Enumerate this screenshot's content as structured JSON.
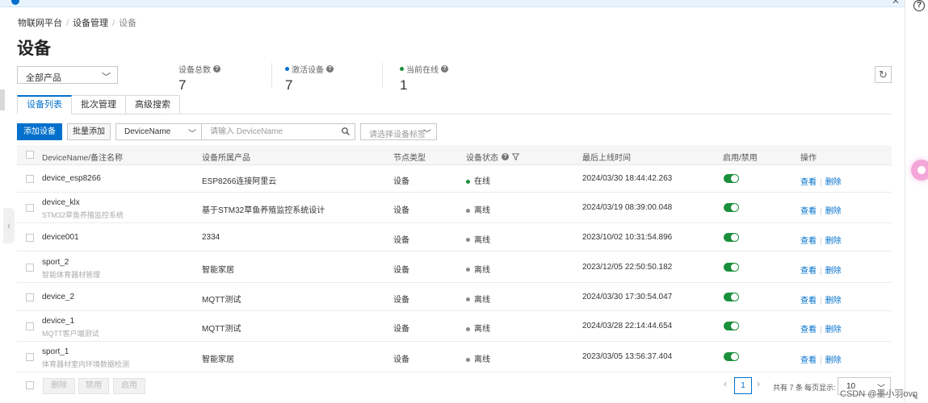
{
  "breadcrumb": [
    "物联网平台",
    "设备管理",
    "设备"
  ],
  "page_title": "设备",
  "product_filter": "全部产品",
  "stats": [
    {
      "label": "设备总数",
      "value": "7",
      "dot": ""
    },
    {
      "label": "激活设备",
      "value": "7",
      "dot": "#0070cc"
    },
    {
      "label": "当前在线",
      "value": "1",
      "dot": "#1b8f3c"
    }
  ],
  "tabs": [
    "设备列表",
    "批次管理",
    "高级搜索"
  ],
  "toolbar": {
    "add_label": "添加设备",
    "batch_label": "批量添加",
    "field_value": "DeviceName",
    "search_placeholder": "请输入 DeviceName",
    "tag_placeholder": "请选择设备标签"
  },
  "columns": {
    "name": "DeviceName/备注名称",
    "product": "设备所属产品",
    "node": "节点类型",
    "status": "设备状态",
    "last_online": "最后上线时间",
    "enable": "启用/禁用",
    "ops": "操作"
  },
  "rows": [
    {
      "name": "device_esp8266",
      "note": "",
      "product": "ESP8266连接阿里云",
      "node": "设备",
      "status": "在线",
      "last_online": "2024/03/30 18:44:42.263"
    },
    {
      "name": "device_klx",
      "note": "STM32草鱼养殖监控系统",
      "product": "基于STM32草鱼养殖监控系统设计",
      "node": "设备",
      "status": "离线",
      "last_online": "2024/03/19 08:39:00.048"
    },
    {
      "name": "device001",
      "note": "",
      "product": "2334",
      "node": "设备",
      "status": "离线",
      "last_online": "2023/10/02 10:31:54.896"
    },
    {
      "name": "sport_2",
      "note": "智能体育器材管理",
      "product": "智能家居",
      "node": "设备",
      "status": "离线",
      "last_online": "2023/12/05 22:50:50.182"
    },
    {
      "name": "device_2",
      "note": "",
      "product": "MQTT测试",
      "node": "设备",
      "status": "离线",
      "last_online": "2024/03/30 17:30:54.047"
    },
    {
      "name": "device_1",
      "note": "MQTT客户端测试",
      "product": "MQTT测试",
      "node": "设备",
      "status": "离线",
      "last_online": "2024/03/28 22:14:44.654"
    },
    {
      "name": "sport_1",
      "note": "体育器材室内环境数据检测",
      "product": "智能家居",
      "node": "设备",
      "status": "离线",
      "last_online": "2023/03/05 13:56:37.404"
    }
  ],
  "row_actions": {
    "view": "查看",
    "delete": "删除"
  },
  "bulk": {
    "delete": "删除",
    "disable": "禁用",
    "enable": "启用"
  },
  "pager": {
    "current": "1",
    "total_text": "共有 7 条",
    "size_label": "每页显示:",
    "size": "10"
  },
  "watermark": "CSDN @墨小羽ovo",
  "colors": {
    "primary": "#0070cc",
    "online": "#1b8f3c",
    "offline": "#888888"
  }
}
